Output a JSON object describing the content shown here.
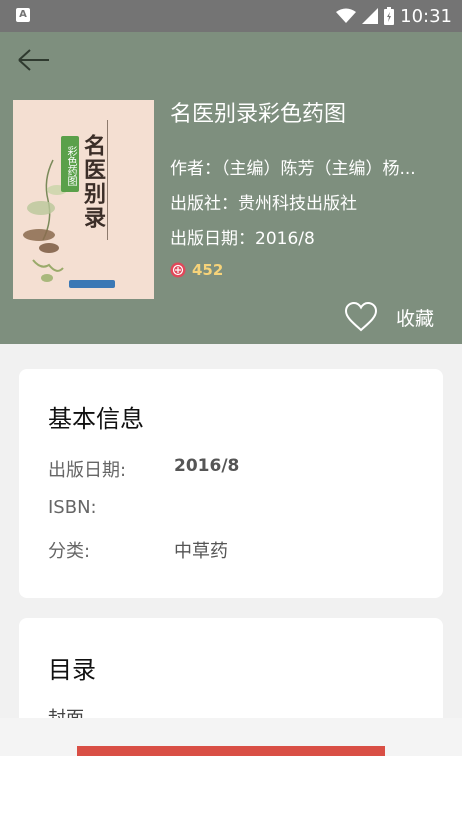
{
  "status_bar": {
    "left_icon_label": "A",
    "time": "10:31",
    "icons": [
      "wifi-icon",
      "signal-icon",
      "battery-icon"
    ]
  },
  "header": {
    "back_icon": "back-arrow-icon",
    "background_color": "#7e8f7e",
    "book": {
      "title": "名医别录彩色药图",
      "author": "作者：（主编）陈芳（主编）杨...",
      "publisher": "出版社：贵州科技出版社",
      "publish_date": "出版日期：2016/8",
      "score": "452",
      "score_icon": "score-badge-icon",
      "cover": {
        "title": "名医别录",
        "badge": "彩色药图"
      }
    },
    "favorite": {
      "icon": "heart-icon",
      "label": "收藏"
    }
  },
  "basic_info": {
    "title": "基本信息",
    "rows": [
      {
        "label": "出版日期:",
        "value": "2016/8"
      },
      {
        "label": "ISBN:",
        "value": ""
      },
      {
        "label": "分类:",
        "value": "中草药"
      }
    ]
  },
  "toc": {
    "title": "目录",
    "items": [
      "封面"
    ]
  },
  "colors": {
    "accent": "#d94f45",
    "status_bar": "#747474",
    "score": "#f6d37a"
  }
}
